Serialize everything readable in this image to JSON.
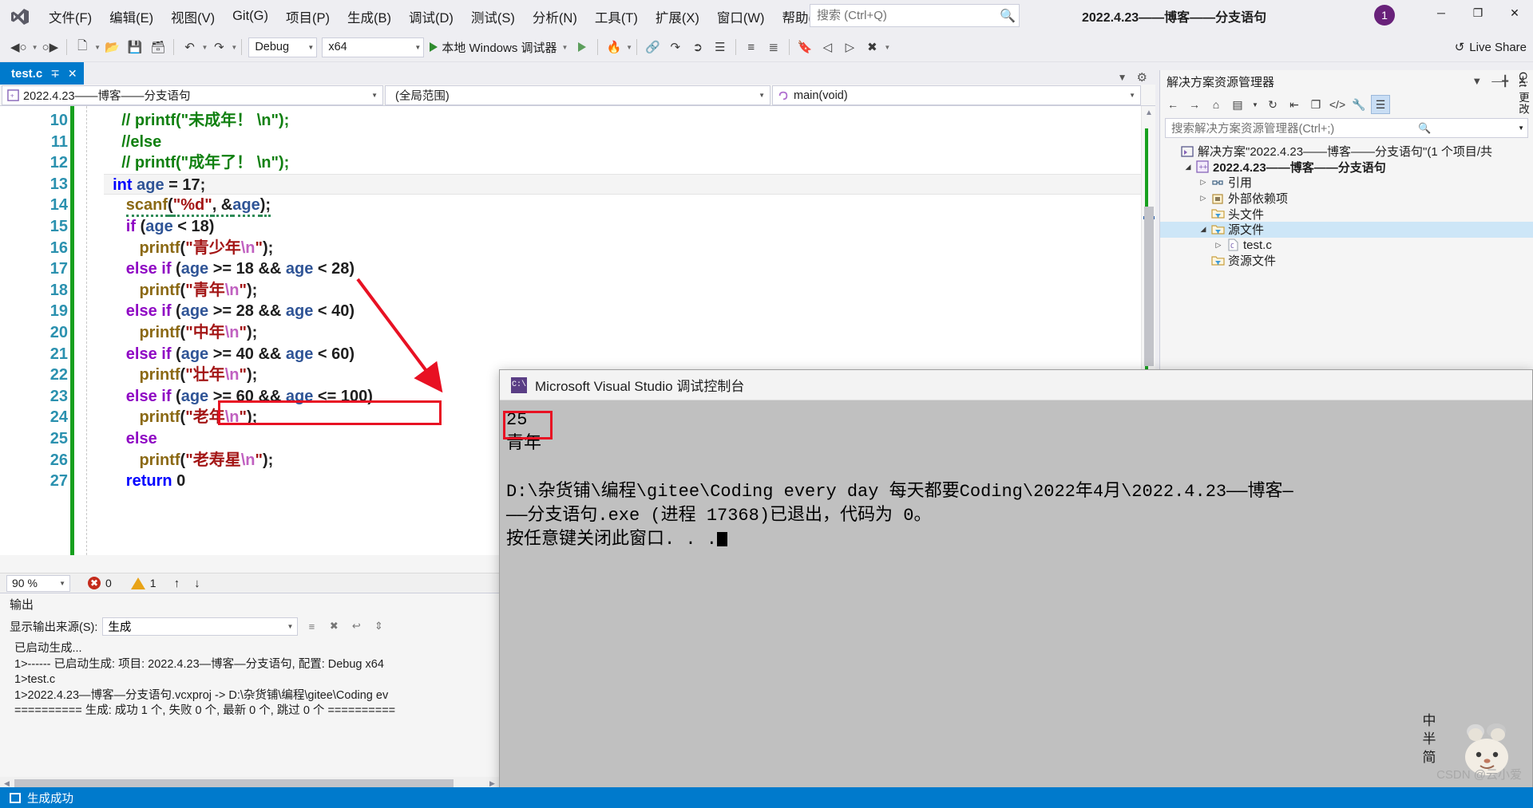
{
  "menu": {
    "items": [
      {
        "label": "文件(F)",
        "name": "menu-file"
      },
      {
        "label": "编辑(E)",
        "name": "menu-edit"
      },
      {
        "label": "视图(V)",
        "name": "menu-view"
      },
      {
        "label": "Git(G)",
        "name": "menu-git"
      },
      {
        "label": "项目(P)",
        "name": "menu-project"
      },
      {
        "label": "生成(B)",
        "name": "menu-build"
      },
      {
        "label": "调试(D)",
        "name": "menu-debug"
      },
      {
        "label": "测试(S)",
        "name": "menu-test"
      },
      {
        "label": "分析(N)",
        "name": "menu-analyze"
      },
      {
        "label": "工具(T)",
        "name": "menu-tools"
      },
      {
        "label": "扩展(X)",
        "name": "menu-extensions"
      },
      {
        "label": "窗口(W)",
        "name": "menu-window"
      },
      {
        "label": "帮助(H)",
        "name": "menu-help"
      }
    ]
  },
  "search": {
    "placeholder": "搜索 (Ctrl+Q)",
    "value": ""
  },
  "window": {
    "title": "2022.4.23——博客——分支语句",
    "account_badge": "1",
    "minimize": "─",
    "maximize": "❐",
    "close": "✕"
  },
  "toolbar": {
    "config": "Debug",
    "platform": "x64",
    "run_label": "本地 Windows 调试器",
    "live_share": "Live Share"
  },
  "editor": {
    "tab_name": "test.c",
    "tab_pin": "∓",
    "tab_close": "✕",
    "scope_left": "2022.4.23——博客——分支语句",
    "scope_mid": "(全局范围)",
    "scope_right": "main(void)",
    "zoom": "90 %",
    "error_count": "0",
    "warning_count": "1",
    "lines": [
      {
        "n": "10",
        "tokens": [
          {
            "t": "    // printf(\"未成年！ \\n\");",
            "c": "k-green"
          }
        ]
      },
      {
        "n": "11",
        "tokens": [
          {
            "t": "    //else",
            "c": "k-green"
          }
        ]
      },
      {
        "n": "12",
        "tokens": [
          {
            "t": "    // printf(\"成年了！ \\n\");",
            "c": "k-green"
          }
        ]
      },
      {
        "n": "13",
        "hl": true,
        "tokens": [
          {
            "t": "  ",
            "c": ""
          },
          {
            "t": "int",
            "c": "k-blue"
          },
          {
            "t": " ",
            "c": ""
          },
          {
            "t": "age",
            "c": "k-var"
          },
          {
            "t": " = ",
            "c": ""
          },
          {
            "t": "17",
            "c": "k-num"
          },
          {
            "t": ";",
            "c": ""
          }
        ]
      },
      {
        "n": "14",
        "tokens": [
          {
            "t": "     ",
            "c": ""
          },
          {
            "t": "scanf",
            "c": "k-fn",
            "sq": true
          },
          {
            "t": "(",
            "c": "",
            "sq": true
          },
          {
            "t": "\"%d\"",
            "c": "k-str",
            "sq": true
          },
          {
            "t": ", &",
            "c": "",
            "sq": true
          },
          {
            "t": "age",
            "c": "k-var",
            "sq": true
          },
          {
            "t": ");",
            "c": "",
            "sq": true
          }
        ]
      },
      {
        "n": "15",
        "tokens": [
          {
            "t": "     ",
            "c": ""
          },
          {
            "t": "if",
            "c": "k-purple"
          },
          {
            "t": " (",
            "c": ""
          },
          {
            "t": "age",
            "c": "k-var"
          },
          {
            "t": " < 18)",
            "c": ""
          }
        ]
      },
      {
        "n": "16",
        "tokens": [
          {
            "t": "        ",
            "c": ""
          },
          {
            "t": "printf",
            "c": "k-fn"
          },
          {
            "t": "(",
            "c": ""
          },
          {
            "t": "\"青少年",
            "c": "k-str"
          },
          {
            "t": "\\n",
            "c": "k-esc"
          },
          {
            "t": "\"",
            "c": "k-str"
          },
          {
            "t": ");",
            "c": ""
          }
        ]
      },
      {
        "n": "17",
        "tokens": [
          {
            "t": "     ",
            "c": ""
          },
          {
            "t": "else if",
            "c": "k-purple"
          },
          {
            "t": " (",
            "c": ""
          },
          {
            "t": "age",
            "c": "k-var"
          },
          {
            "t": " >= 18 && ",
            "c": ""
          },
          {
            "t": "age",
            "c": "k-var"
          },
          {
            "t": " < 28)",
            "c": ""
          }
        ]
      },
      {
        "n": "18",
        "tokens": [
          {
            "t": "        ",
            "c": ""
          },
          {
            "t": "printf",
            "c": "k-fn"
          },
          {
            "t": "(",
            "c": ""
          },
          {
            "t": "\"青年",
            "c": "k-str"
          },
          {
            "t": "\\n",
            "c": "k-esc"
          },
          {
            "t": "\"",
            "c": "k-str"
          },
          {
            "t": ");",
            "c": ""
          }
        ]
      },
      {
        "n": "19",
        "tokens": [
          {
            "t": "     ",
            "c": ""
          },
          {
            "t": "else if",
            "c": "k-purple"
          },
          {
            "t": " (",
            "c": ""
          },
          {
            "t": "age",
            "c": "k-var"
          },
          {
            "t": " >= 28 && ",
            "c": ""
          },
          {
            "t": "age",
            "c": "k-var"
          },
          {
            "t": " < 40)",
            "c": ""
          }
        ]
      },
      {
        "n": "20",
        "tokens": [
          {
            "t": "        ",
            "c": ""
          },
          {
            "t": "printf",
            "c": "k-fn"
          },
          {
            "t": "(",
            "c": ""
          },
          {
            "t": "\"中年",
            "c": "k-str"
          },
          {
            "t": "\\n",
            "c": "k-esc"
          },
          {
            "t": "\"",
            "c": "k-str"
          },
          {
            "t": ");",
            "c": ""
          }
        ]
      },
      {
        "n": "21",
        "tokens": [
          {
            "t": "     ",
            "c": ""
          },
          {
            "t": "else if",
            "c": "k-purple"
          },
          {
            "t": " (",
            "c": ""
          },
          {
            "t": "age",
            "c": "k-var"
          },
          {
            "t": " >= 40 && ",
            "c": ""
          },
          {
            "t": "age",
            "c": "k-var"
          },
          {
            "t": " < 60)",
            "c": ""
          }
        ]
      },
      {
        "n": "22",
        "tokens": [
          {
            "t": "        ",
            "c": ""
          },
          {
            "t": "printf",
            "c": "k-fn"
          },
          {
            "t": "(",
            "c": ""
          },
          {
            "t": "\"壮年",
            "c": "k-str"
          },
          {
            "t": "\\n",
            "c": "k-esc"
          },
          {
            "t": "\"",
            "c": "k-str"
          },
          {
            "t": ");",
            "c": ""
          }
        ]
      },
      {
        "n": "23",
        "tokens": [
          {
            "t": "     ",
            "c": ""
          },
          {
            "t": "else if",
            "c": "k-purple"
          },
          {
            "t": " (",
            "c": ""
          },
          {
            "t": "age",
            "c": "k-var"
          },
          {
            "t": " >= 60 && ",
            "c": ""
          },
          {
            "t": "age",
            "c": "k-var"
          },
          {
            "t": " <= 100)",
            "c": ""
          }
        ]
      },
      {
        "n": "24",
        "tokens": [
          {
            "t": "        ",
            "c": ""
          },
          {
            "t": "printf",
            "c": "k-fn"
          },
          {
            "t": "(",
            "c": ""
          },
          {
            "t": "\"老年",
            "c": "k-str"
          },
          {
            "t": "\\n",
            "c": "k-esc"
          },
          {
            "t": "\"",
            "c": "k-str"
          },
          {
            "t": ");",
            "c": ""
          }
        ]
      },
      {
        "n": "25",
        "tokens": [
          {
            "t": "     ",
            "c": ""
          },
          {
            "t": "else",
            "c": "k-purple"
          }
        ]
      },
      {
        "n": "26",
        "tokens": [
          {
            "t": "        ",
            "c": ""
          },
          {
            "t": "printf",
            "c": "k-fn"
          },
          {
            "t": "(",
            "c": ""
          },
          {
            "t": "\"老寿星",
            "c": "k-str"
          },
          {
            "t": "\\n",
            "c": "k-esc"
          },
          {
            "t": "\"",
            "c": "k-str"
          },
          {
            "t": ");",
            "c": ""
          }
        ]
      },
      {
        "n": "27",
        "tokens": [
          {
            "t": "     ",
            "c": ""
          },
          {
            "t": "return",
            "c": "k-blue"
          },
          {
            "t": " 0",
            "c": ""
          }
        ]
      }
    ]
  },
  "output": {
    "title": "输出",
    "source_label": "显示输出来源(S):",
    "source_value": "生成",
    "body": "已启动生成...\n1>------ 已启动生成: 项目: 2022.4.23—博客—分支语句, 配置: Debug x64\n1>test.c\n1>2022.4.23—博客—分支语句.vcxproj -> D:\\杂货铺\\编程\\gitee\\Coding ev\n========== 生成: 成功 1 个, 失败 0 个, 最新 0 个, 跳过 0 个 =========="
  },
  "solution_explorer": {
    "title": "解决方案资源管理器",
    "search_placeholder": "搜索解决方案资源管理器(Ctrl+;)",
    "tree": [
      {
        "label": "解决方案\"2022.4.23——博客——分支语句\"(1 个项目/共",
        "icon": "solution-icon",
        "indent": 0,
        "arrow": "",
        "bold": false,
        "selected": false
      },
      {
        "label": "2022.4.23——博客——分支语句",
        "icon": "project-icon",
        "indent": 1,
        "arrow": "◢",
        "bold": true,
        "selected": false
      },
      {
        "label": "引用",
        "icon": "references-icon",
        "indent": 2,
        "arrow": "▷",
        "bold": false,
        "selected": false
      },
      {
        "label": "外部依赖项",
        "icon": "deps-icon",
        "indent": 2,
        "arrow": "▷",
        "bold": false,
        "selected": false
      },
      {
        "label": "头文件",
        "icon": "folder-filter-icon",
        "indent": 2,
        "arrow": "",
        "bold": false,
        "selected": false
      },
      {
        "label": "源文件",
        "icon": "folder-filter-icon",
        "indent": 2,
        "arrow": "◢",
        "bold": false,
        "selected": true
      },
      {
        "label": "test.c",
        "icon": "c-file-icon",
        "indent": 3,
        "arrow": "▷",
        "bold": false,
        "selected": false
      },
      {
        "label": "资源文件",
        "icon": "folder-filter-icon",
        "indent": 2,
        "arrow": "",
        "bold": false,
        "selected": false
      }
    ],
    "side_tab": "Git 更改"
  },
  "console_window": {
    "title": "Microsoft Visual Studio 调试控制台",
    "input_value": "25",
    "output_value": "青年",
    "exit_line_1": "D:\\杂货铺\\编程\\gitee\\Coding every day 每天都要Coding\\2022年4月\\2022.4.23——博客—",
    "exit_line_2": "——分支语句.exe (进程 17368)已退出，代码为 0。",
    "prompt_line": "按任意键关闭此窗口. . ."
  },
  "statusbar": {
    "build_status": "生成成功"
  },
  "ime": {
    "line1": "中",
    "line2": "半",
    "line3": "简"
  },
  "watermark": "CSDN @云小爱"
}
